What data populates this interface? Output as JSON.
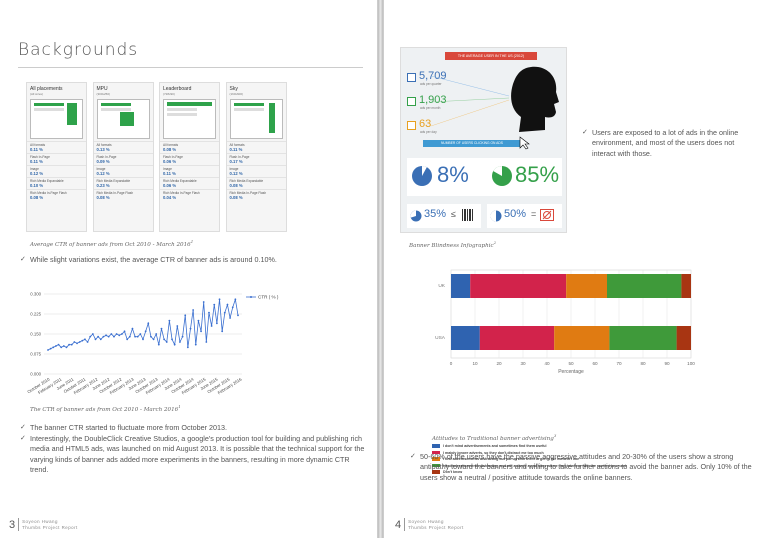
{
  "left_page": {
    "title": "Backgrounds",
    "banner_panels": [
      {
        "name": "All placements",
        "sub": "(All sizes)",
        "metrics": [
          [
            "All formats",
            "0.11 %"
          ],
          [
            "Flash In-Page",
            "0.11 %"
          ],
          [
            "Image",
            "0.12 %"
          ],
          [
            "Rich Media Expandable",
            "0.10 %"
          ],
          [
            "Rich Media In-Page Flash",
            "0.08 %"
          ]
        ]
      },
      {
        "name": "MPU",
        "sub": "(300x250)",
        "metrics": [
          [
            "All formats",
            "0.13 %"
          ],
          [
            "Flash In-Page",
            "0.09 %"
          ],
          [
            "Image",
            "0.12 %"
          ],
          [
            "Rich Media Expandable",
            "0.23 %"
          ],
          [
            "Rich Media In-Page Flash",
            "0.08 %"
          ]
        ]
      },
      {
        "name": "Leaderboard",
        "sub": "(728x90)",
        "metrics": [
          [
            "All formats",
            "0.08 %"
          ],
          [
            "Flash In-Page",
            "0.06 %"
          ],
          [
            "Image",
            "0.11 %"
          ],
          [
            "Rich Media Expandable",
            "0.06 %"
          ],
          [
            "Rich Media In-Page Flash",
            "0.04 %"
          ]
        ]
      },
      {
        "name": "Sky",
        "sub": "(160x600)",
        "metrics": [
          [
            "All formats",
            "0.11 %"
          ],
          [
            "Flash In-Page",
            "0.17 %"
          ],
          [
            "Image",
            "0.12 %"
          ],
          [
            "Rich Media Expandable",
            "0.08 %"
          ],
          [
            "Rich Media In-Page Flash",
            "0.08 %"
          ]
        ]
      }
    ],
    "caption1": "Average CTR of banner ads from Oct 2010 - March 2016",
    "caption1_sup": "1",
    "bullet1": "While slight variations exist, the average CTR of banner ads is around 0.10%.",
    "caption2": "The CTR of banner ads from Oct 2010 - March 2016",
    "caption2_sup": "1",
    "bullet2": "The banner CTR started to fluctuate more from October 2013.",
    "bullet3": "Interestingly, the DoubleClick Creative Studios, a google's production tool for building and publishing rich media and HTML5 ads, was launched on mid August 2013. It is possible that the technical support for the varying kinds of banner ads added more experiments in the banners, resulting in more dynamic CTR trend.",
    "page_number": "3",
    "author": "Soyeon Hwang",
    "report": "Thumbs Project Report"
  },
  "right_page": {
    "info_title": "THE AVERAGE USER IN THE US (2012)",
    "info_stats": [
      {
        "value": "5,709",
        "label": "ads per quarter",
        "color": "#3a6fb5"
      },
      {
        "value": "1,903",
        "label": "ads per month",
        "color": "#34a04a"
      },
      {
        "value": "63",
        "label": "ads per day",
        "color": "#e8a020"
      }
    ],
    "info_mid_banner": "NUMBER OF USERS CLICKING ON ADS",
    "info_pct_a": "8%",
    "info_pct_b": "85%",
    "info_pct_c": "35%",
    "info_pct_d": "50%",
    "info_caption": "Banner Blindness Infographic",
    "info_caption_sup": "2",
    "bullet4": "Users are exposed to a lot of ads in the online environment, and most of the users does not interact with those.",
    "caption3": "Attitudes to Traditional banner advertising",
    "caption3_sup": "3",
    "bullet5": "50-60% of the users have the passive aggressive attitudes and 20-30% of the users show a strong antipathy toward the banners and willing to take further actions to avoid the banner ads. Only 10% of the users show a neutral / positive attitude towards the online banners.",
    "page_number": "4",
    "author": "Soyeon Hwang",
    "report": "Thumbs Project Report"
  },
  "chart_data": [
    {
      "type": "line",
      "title": "",
      "legend": "CTR ( % )",
      "legend_position": "top-right",
      "yticks": [
        "0.000",
        "0.075",
        "0.150",
        "0.225",
        "0.300"
      ],
      "ylim": [
        0,
        0.3
      ],
      "xticks": [
        "October 2010",
        "February 2011",
        "June 2011",
        "October 2011",
        "February 2012",
        "June 2012",
        "October 2012",
        "February 2013",
        "June 2013",
        "October 2013",
        "February 2014",
        "June 2014",
        "October 2014",
        "February 2015",
        "June 2015",
        "October 2015",
        "February 2016"
      ],
      "grid": true,
      "values": [
        0.09,
        0.095,
        0.1,
        0.105,
        0.11,
        0.1,
        0.105,
        0.1,
        0.11,
        0.11,
        0.12,
        0.115,
        0.12,
        0.125,
        0.13,
        0.12,
        0.14,
        0.15,
        0.13,
        0.14,
        0.13,
        0.14,
        0.145,
        0.14,
        0.15,
        0.14,
        0.15,
        0.145,
        0.15,
        0.16,
        0.13,
        0.14,
        0.17,
        0.14,
        0.14,
        0.15,
        0.13,
        0.16,
        0.19,
        0.14,
        0.13,
        0.15,
        0.11,
        0.17,
        0.13,
        0.12,
        0.2,
        0.13,
        0.11,
        0.18,
        0.12,
        0.14,
        0.22,
        0.1,
        0.17,
        0.24,
        0.11,
        0.2,
        0.16,
        0.27,
        0.12,
        0.23,
        0.18,
        0.26,
        0.19,
        0.28,
        0.16,
        0.23,
        0.26,
        0.21,
        0.25,
        0.28,
        0.22
      ]
    },
    {
      "type": "bar",
      "orientation": "horizontal",
      "stacked": true,
      "categories": [
        "UK",
        "USA"
      ],
      "xlabel": "Percentage",
      "xlim": [
        0,
        100
      ],
      "xticks": [
        "0",
        "10",
        "20",
        "30",
        "40",
        "50",
        "60",
        "70",
        "80",
        "90",
        "100"
      ],
      "series": [
        {
          "name": "I don't mind advertisements and sometimes find them useful",
          "color": "#2f63b0",
          "values": [
            8,
            12
          ]
        },
        {
          "name": "I mainly ignore adverts, so they don't distract me too much",
          "color": "#d2234b",
          "values": [
            40,
            31
          ]
        },
        {
          "name": "I find advertisements distracting but put up with them to get to the content I like",
          "color": "#e07b12",
          "values": [
            17,
            23
          ]
        },
        {
          "name": "I find advertisements distracting and will actively avoid sites where they interfere with the content too much",
          "color": "#3f9a3a",
          "values": [
            31,
            28
          ]
        },
        {
          "name": "Don't know",
          "color": "#a83512",
          "values": [
            4,
            6
          ]
        }
      ]
    }
  ]
}
